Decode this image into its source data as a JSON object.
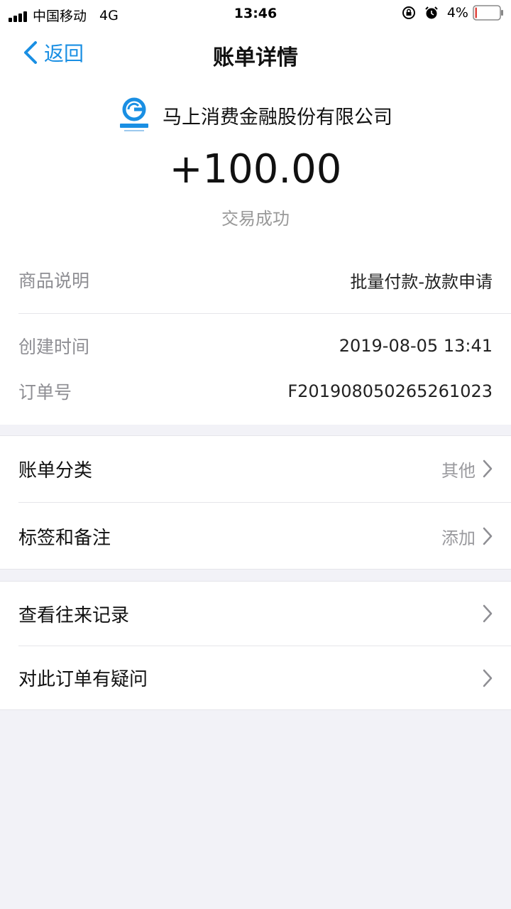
{
  "status_bar": {
    "carrier": "中国移动",
    "network": "4G",
    "time": "13:46",
    "battery": "4%"
  },
  "nav": {
    "back_label": "返回",
    "title": "账单详情"
  },
  "merchant": {
    "name": "马上消费金融股份有限公司",
    "logo_icon": "mashang-finance-logo-icon"
  },
  "transaction": {
    "amount": "+100.00",
    "status": "交易成功"
  },
  "details": [
    {
      "label": "商品说明",
      "value": "批量付款-放款申请"
    },
    {
      "label": "创建时间",
      "value": "2019-08-05 13:41"
    },
    {
      "label": "订单号",
      "value": "F201908050265261023"
    }
  ],
  "settings": [
    {
      "label": "账单分类",
      "value": "其他"
    },
    {
      "label": "标签和备注",
      "value": "添加"
    }
  ],
  "actions": [
    {
      "label": "查看往来记录"
    },
    {
      "label": "对此订单有疑问"
    }
  ],
  "colors": {
    "accent": "#1a8fe3",
    "background": "#f2f2f7",
    "battery_low": "#e0443e"
  }
}
